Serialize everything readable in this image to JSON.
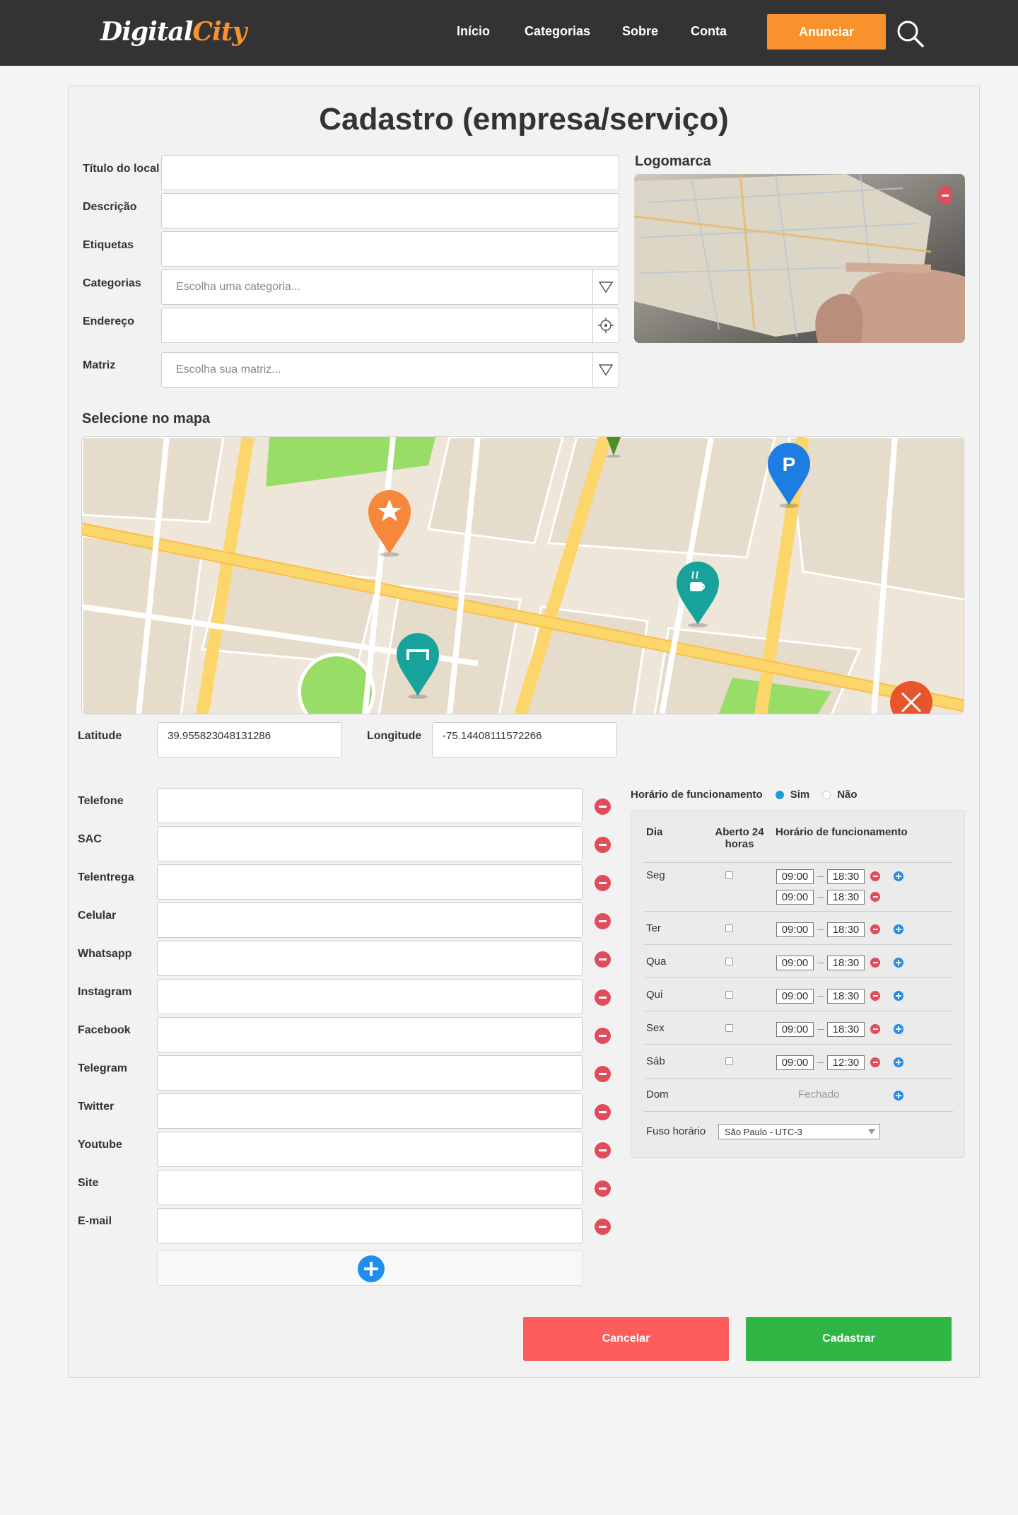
{
  "header": {
    "logo_part1": "Digital",
    "logo_part2": "City",
    "nav": [
      "Início",
      "Categorias",
      "Sobre",
      "Conta"
    ],
    "cta_label": "Anunciar",
    "accent_color": "#f7922c",
    "search_icon": "search-icon"
  },
  "form": {
    "title": "Cadastro (empresa/serviço)",
    "fields": {
      "title_label": "Título do local",
      "description_label": "Descrição",
      "tags_label": "Etiquetas",
      "categories_label": "Categorias",
      "categories_placeholder": "Escolha uma categoria...",
      "address_label": "Endereço",
      "matrix_label": "Matriz",
      "matrix_placeholder": "Escolha sua matriz..."
    },
    "logo_label": "Logomarca",
    "map_label": "Selecione no mapa",
    "latitude_label": "Latitude",
    "latitude_value": "39.955823048131286",
    "longitude_label": "Longitude",
    "longitude_value": "-75.14408111572266",
    "contacts": [
      "Telefone",
      "SAC",
      "Telentrega",
      "Celular",
      "Whatsapp",
      "Instagram",
      "Facebook",
      "Telegram",
      "Twitter",
      "Youtube",
      "Site",
      "E-mail"
    ]
  },
  "hours": {
    "title": "Horário de funcionamento",
    "yes_label": "Sim",
    "no_label": "Não",
    "selected": "Sim",
    "col_day": "Dia",
    "col_24h": "Aberto 24 horas",
    "col_hours": "Horário de funcionamento",
    "days": [
      {
        "day": "Seg",
        "slots": [
          [
            "09:00",
            "18:30"
          ],
          [
            "09:00",
            "18:30"
          ]
        ]
      },
      {
        "day": "Ter",
        "slots": [
          [
            "09:00",
            "18:30"
          ]
        ]
      },
      {
        "day": "Qua",
        "slots": [
          [
            "09:00",
            "18:30"
          ]
        ]
      },
      {
        "day": "Qui",
        "slots": [
          [
            "09:00",
            "18:30"
          ]
        ]
      },
      {
        "day": "Sex",
        "slots": [
          [
            "09:00",
            "18:30"
          ]
        ]
      },
      {
        "day": "Sáb",
        "slots": [
          [
            "09:00",
            "12:30"
          ]
        ]
      },
      {
        "day": "Dom",
        "closed_label": "Fechado"
      }
    ],
    "timezone_label": "Fuso horário",
    "timezone_value": "São Paulo - UTC-3"
  },
  "actions": {
    "cancel_label": "Cancelar",
    "submit_label": "Cadastrar",
    "cancel_color": "#fd5d5d",
    "submit_color": "#2eb543"
  },
  "map_pins": [
    "star-pin-icon",
    "parking-pin-icon",
    "coffee-pin-icon",
    "hotel-pin-icon",
    "restaurant-pin-icon"
  ]
}
